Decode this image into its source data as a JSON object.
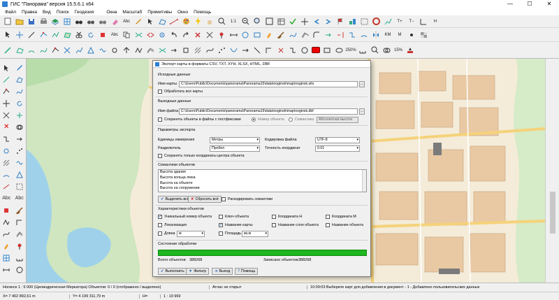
{
  "window": {
    "title": "ГИС \"Панорама\" версия 15.5.6.1 x64",
    "controls": [
      "—",
      "☐",
      "✕"
    ]
  },
  "menu": {
    "items": [
      "Файл",
      "Правка",
      "Вид",
      "Поиск",
      "Геодезия"
    ],
    "mdi_items": [
      "Окна",
      "Масштаб",
      "Примитивы",
      "Окно",
      "Помощь"
    ]
  },
  "toolbar_labels": {
    "one_to_one": "1:1",
    "abc": "Abc",
    "pct_250": "250%",
    "pct_15": "15%",
    "km": "KM",
    "m": "M"
  },
  "dialog": {
    "title": "Экспорт карты в форматы CSV, TXT, XYH, XLSX, HTML, DBF",
    "source": {
      "header": "Исходные данные",
      "map_label": "Имя карты",
      "map_value": "C:\\Users\\Public\\Documents\\panorama\\Panorama15\\data\\noginsk\\map\\noginsk.sitx",
      "process_all_label": "Обработать все карты",
      "process_all_checked": false
    },
    "output": {
      "header": "Выходные данные",
      "file_label": "Имя файла",
      "file_value": "C:\\Users\\Public\\Documents\\panorama\\Panorama15\\data\\noginsk\\map\\noginsk.dbf",
      "save_split_label": "Сохранять объекты в файлы с постфиксами",
      "save_split_checked": false,
      "radio_number": "Номер объекта",
      "radio_semantic": "Семантика",
      "abs_height_placeholder": "Абсолютная высота"
    },
    "params": {
      "header": "Параметры экспорта",
      "units_label": "Единицы измерения",
      "units_value": "Метры",
      "encoding_label": "Кодировка файла",
      "encoding_value": "UTF-8",
      "separator_label": "Разделитель",
      "separator_value": "Пробел",
      "precision_label": "Точность координат",
      "precision_value": "0.01",
      "center_only_label": "Сохранять только координаты центра объекта",
      "center_only_checked": false
    },
    "semantics": {
      "header": "Семантики объектов",
      "items": [
        "Высота здания",
        "Высота кольца люка",
        "Высота на объекте",
        "Высота на сооружении"
      ],
      "select_all": "Выделить всё",
      "reset_all": "Сбросить всё",
      "decode_label": "Раскодировать семантики",
      "decode_checked": false
    },
    "characteristics": {
      "header": "Характеристики объектов",
      "unique_id": "Уникальный номер объекта",
      "object_key": "Ключ объекта",
      "coord_h": "Координата H",
      "coord_m": "Координата M",
      "localization": "Локализация",
      "map_name": "Название карты",
      "layer_name": "Название слоя объекта",
      "object_name": "Название объекта",
      "length": "Длина",
      "length_unit": "м",
      "area": "Площадь",
      "area_unit": "кв.м",
      "checked": {
        "unique_id": true,
        "object_key": false,
        "coord_h": false,
        "coord_m": false,
        "localization": false,
        "map_name": true,
        "layer_name": false,
        "object_name": false,
        "length": false,
        "area": false
      }
    },
    "status": {
      "header": "Состояние обработки",
      "progress_percent": 100,
      "total_label": "Всего объектов:",
      "total_value": "388268",
      "written_label": "Записано объектов:",
      "written_value": "388268"
    },
    "buttons": {
      "run": "Выполнить",
      "filter": "Фильтр",
      "exit": "Выход",
      "help": "Помощь"
    }
  },
  "status_bar": {
    "left": "Ногинск  1 : 5 000 (Цилиндрическая Меркатора) Объектов: 0 / 0 (отображено / выделено)",
    "atlas": "Атлас не открыт",
    "message": "10:09:03  Выберите карт для добавления в документ - 1 - Добавлено пользовательских данных",
    "coords_x": "X= 7 402 892,61 m",
    "coords_y": "Y= 4 199 311,79 m",
    "coords_h": "H=",
    "scale": "1 : 19 969"
  },
  "colors": {
    "progress": "#1fb61f",
    "map_bg": "#f4ecd9",
    "accent_icon": "#1a5fb4"
  }
}
